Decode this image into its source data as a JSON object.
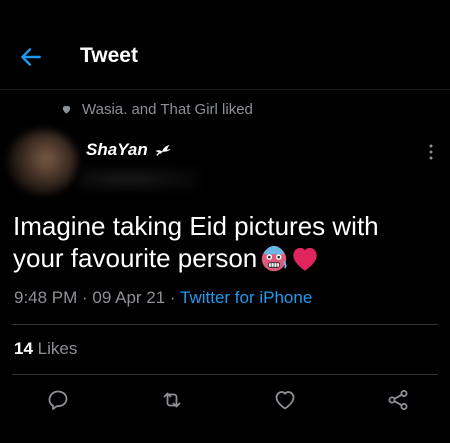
{
  "header": {
    "title": "Tweet"
  },
  "social_context": {
    "text": "Wasia. and That Girl liked"
  },
  "author": {
    "name": "ShaYan"
  },
  "tweet": {
    "line1": "Imagine taking Eid pictures with",
    "line2": "your favourite person"
  },
  "meta": {
    "time": "9:48 PM",
    "sep1": " · ",
    "date": "09 Apr 21",
    "sep2": " · ",
    "source": "Twitter for iPhone"
  },
  "stats": {
    "likes_count": "14",
    "likes_label": " Likes"
  },
  "icons": {
    "back": "arrow-left-icon",
    "social_heart": "heart-icon",
    "dove": "dove-icon",
    "more": "more-vertical-icon",
    "reply": "reply-icon",
    "retweet": "retweet-icon",
    "like": "heart-icon",
    "share": "share-icon"
  },
  "colors": {
    "background": "#000000",
    "accent": "#1d9bf0",
    "secondary_text": "#8b9196",
    "primary_text": "#ffffff",
    "heart_emoji": "#e0245e"
  }
}
